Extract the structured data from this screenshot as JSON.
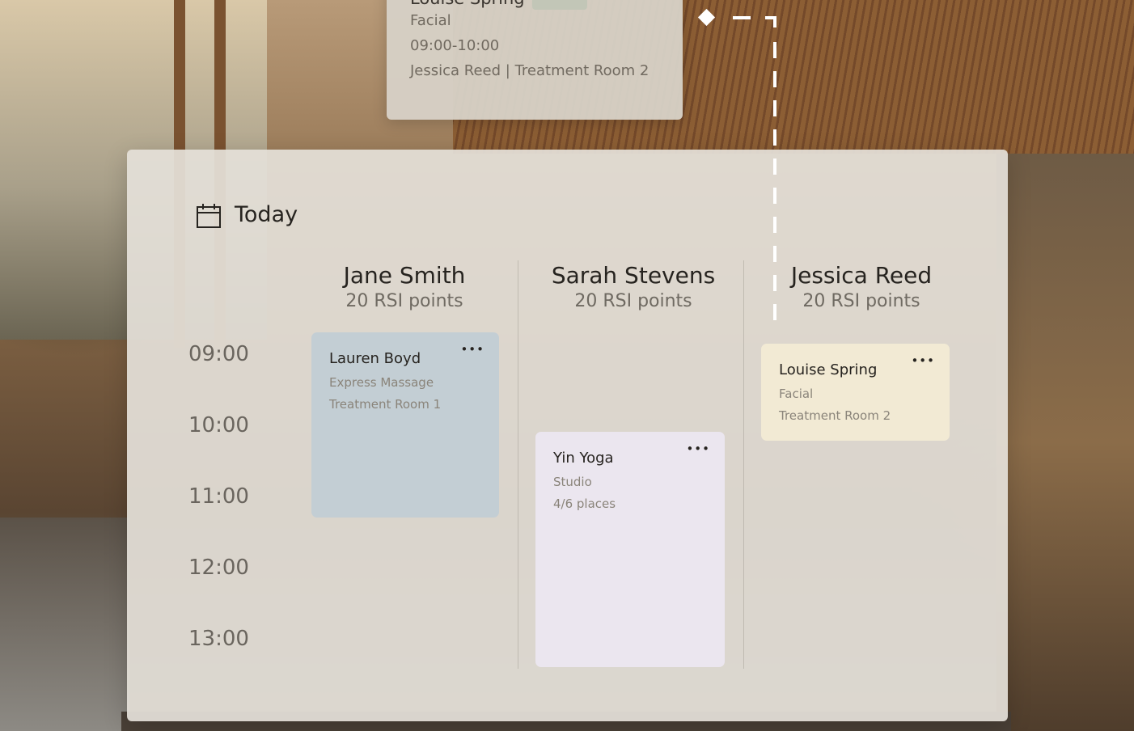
{
  "popup": {
    "client": "Louise Spring",
    "service": "Facial",
    "time_range": "09:00-10:00",
    "details": "Jessica Reed | Treatment Room 2"
  },
  "header": {
    "title": "Today",
    "icon": "calendar-icon"
  },
  "staff": [
    {
      "name": "Jane Smith",
      "points": "20 RSI points"
    },
    {
      "name": "Sarah Stevens",
      "points": "20 RSI points"
    },
    {
      "name": "Jessica Reed",
      "points": "20 RSI points"
    }
  ],
  "times": [
    "09:00",
    "10:00",
    "11:00",
    "12:00",
    "13:00"
  ],
  "appointments": [
    {
      "title": "Lauren Boyd",
      "line1": "Express Massage",
      "line2": "Treatment Room 1",
      "more": "•••",
      "color": "#c3ced4"
    },
    {
      "title": "Yin Yoga",
      "line1": "Studio",
      "line2": "4/6 places",
      "more": "•••",
      "color": "#ebe6ef"
    },
    {
      "title": "Louise Spring",
      "line1": "Facial",
      "line2": "Treatment Room 2",
      "more": "•••",
      "color": "#f2ead4"
    }
  ]
}
